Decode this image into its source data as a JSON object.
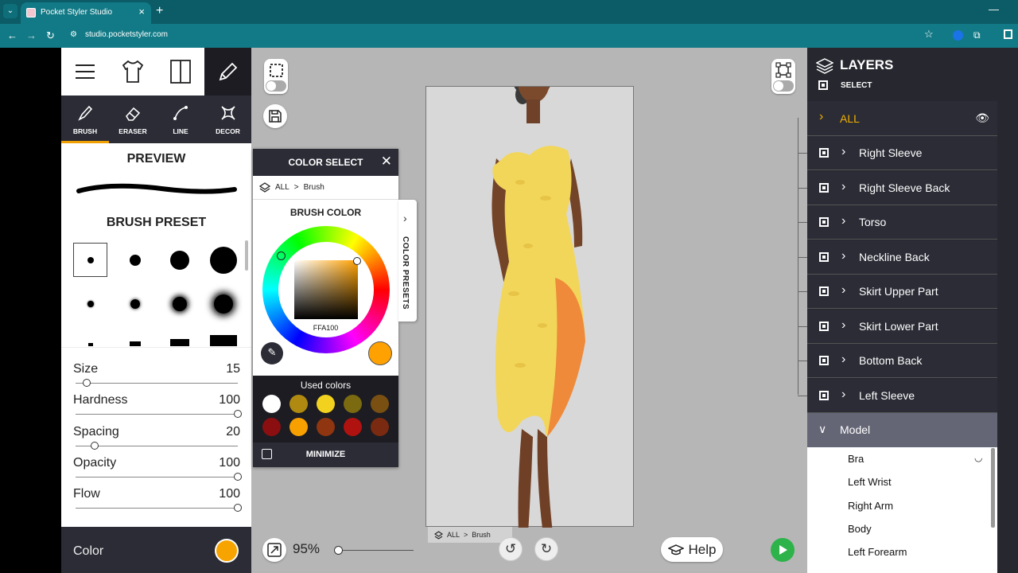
{
  "browser": {
    "tab_title": "Pocket Styler Studio",
    "url": "studio.pocketstyler.com"
  },
  "left_panel": {
    "tools": [
      {
        "label": "BRUSH",
        "icon": "brush-icon",
        "selected": true
      },
      {
        "label": "ERASER",
        "icon": "eraser-icon",
        "selected": false
      },
      {
        "label": "LINE",
        "icon": "line-icon",
        "selected": false
      },
      {
        "label": "DECOR",
        "icon": "decor-icon",
        "selected": false
      }
    ],
    "preview_title": "PREVIEW",
    "preset_title": "BRUSH PRESET",
    "sliders": [
      {
        "label": "Size",
        "value": "15",
        "fraction": 0.07
      },
      {
        "label": "Hardness",
        "value": "100",
        "fraction": 1.0
      },
      {
        "label": "Spacing",
        "value": "20",
        "fraction": 0.12
      },
      {
        "label": "Opacity",
        "value": "100",
        "fraction": 1.0
      },
      {
        "label": "Flow",
        "value": "100",
        "fraction": 1.0
      }
    ],
    "color_label": "Color",
    "color_value": "#f7a300"
  },
  "color_select": {
    "title": "COLOR SELECT",
    "breadcrumb_root": "ALL",
    "breadcrumb_sep": ">",
    "breadcrumb_leaf": "Brush",
    "label": "BRUSH COLOR",
    "hex": "FFA100",
    "used_title": "Used colors",
    "used_colors": [
      "#ffffff",
      "#b08a10",
      "#f2d21e",
      "#7b6a10",
      "#7a4f12",
      "#8b0f10",
      "#f7a000",
      "#8f3510",
      "#b01210",
      "#7a2a10"
    ],
    "minimize_label": "MINIMIZE",
    "presets_tab_label": "COLOR PRESETS"
  },
  "canvas": {
    "breadcrumb_root": "ALL",
    "breadcrumb_sep": ">",
    "breadcrumb_leaf": "Brush",
    "zoom": "95%",
    "zoom_fraction": 0.0,
    "help_label": "Help"
  },
  "layers": {
    "title": "LAYERS",
    "select_label": "SELECT",
    "all_label": "ALL",
    "items": [
      "Right Sleeve",
      "Right Sleeve Back",
      "Torso",
      "Neckline Back",
      "Skirt Upper Part",
      "Skirt Lower Part",
      "Bottom Back",
      "Left Sleeve"
    ],
    "model_label": "Model",
    "model_items": [
      "Bra",
      "Left Wrist",
      "Right Arm",
      "Body",
      "Left Forearm"
    ]
  }
}
